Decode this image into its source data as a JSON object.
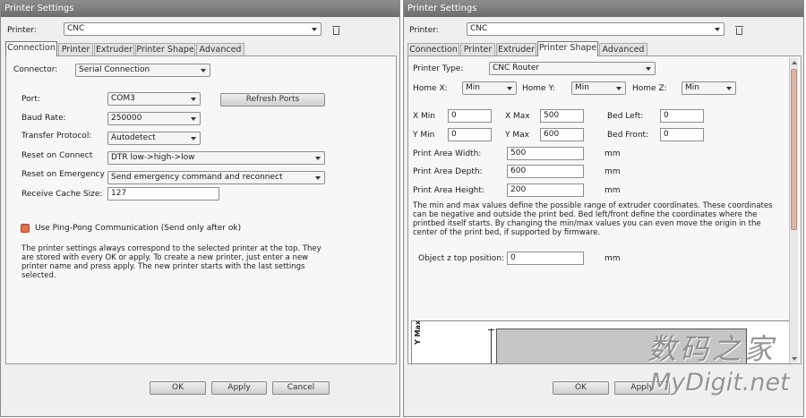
{
  "left": {
    "title": "Printer Settings",
    "printer_label": "Printer:",
    "printer_value": "CNC",
    "tabs": [
      "Connection",
      "Printer",
      "Extruder",
      "Printer Shape",
      "Advanced"
    ],
    "active_tab": "Connection",
    "connector_label": "Connector:",
    "connector_value": "Serial Connection",
    "port_label": "Port:",
    "port_value": "COM3",
    "refresh_ports": "Refresh Ports",
    "baud_label": "Baud Rate:",
    "baud_value": "250000",
    "protocol_label": "Transfer Protocol:",
    "protocol_value": "Autodetect",
    "reset_connect_label": "Reset on Connect",
    "reset_connect_value": "DTR low->high->low",
    "reset_emergency_label": "Reset on Emergency",
    "reset_emergency_value": "Send emergency command and reconnect",
    "cache_label": "Receive Cache Size:",
    "cache_value": "127",
    "pingpong_label": "Use Ping-Pong Communication (Send only after ok)",
    "info_lines": [
      "The printer settings always correspond to the selected printer at the top.  They",
      "are stored with every OK or apply. To create a new printer, just enter a new",
      "printer name and press apply. The new printer starts with the last settings",
      "selected."
    ],
    "ok": "OK",
    "apply": "Apply",
    "cancel": "Cancel"
  },
  "right": {
    "title": "Printer Settings",
    "printer_label": "Printer:",
    "printer_value": "CNC",
    "tabs": [
      "Connection",
      "Printer",
      "Extruder",
      "Printer Shape",
      "Advanced"
    ],
    "active_tab": "Printer Shape",
    "printer_type_label": "Printer Type:",
    "printer_type_value": "CNC Router",
    "home_x_label": "Home X:",
    "home_x_value": "Min",
    "home_y_label": "Home Y:",
    "home_y_value": "Min",
    "home_z_label": "Home Z:",
    "home_z_value": "Min",
    "xmin_label": "X Min",
    "xmin_value": "0",
    "xmax_label": "X Max",
    "xmax_value": "500",
    "bed_left_label": "Bed Left:",
    "bed_left_value": "0",
    "ymin_label": "Y Min",
    "ymin_value": "0",
    "ymax_label": "Y Max",
    "ymax_value": "600",
    "bed_front_label": "Bed Front:",
    "bed_front_value": "0",
    "width_label": "Print Area Width:",
    "width_value": "500",
    "depth_label": "Print Area Depth:",
    "depth_value": "600",
    "height_label": "Print Area Height:",
    "height_value": "200",
    "unit": "mm",
    "info_lines": [
      "The min and max values define the possible range of extruder coordinates. These coordinates",
      "can be negative and outside the print bed. Bed left/front define the coordinates where the",
      "printbed itself starts. By changing the min/max values you can even move the origin in the",
      "center of the print bed, if supported by firmware."
    ],
    "ztop_label": "Object z top position:",
    "ztop_value": "0",
    "preview_axis_label": "Y Max",
    "ok": "OK",
    "apply": "Apply"
  },
  "watermark": {
    "line1": "数码之家",
    "line2": "MyDigit.net"
  }
}
